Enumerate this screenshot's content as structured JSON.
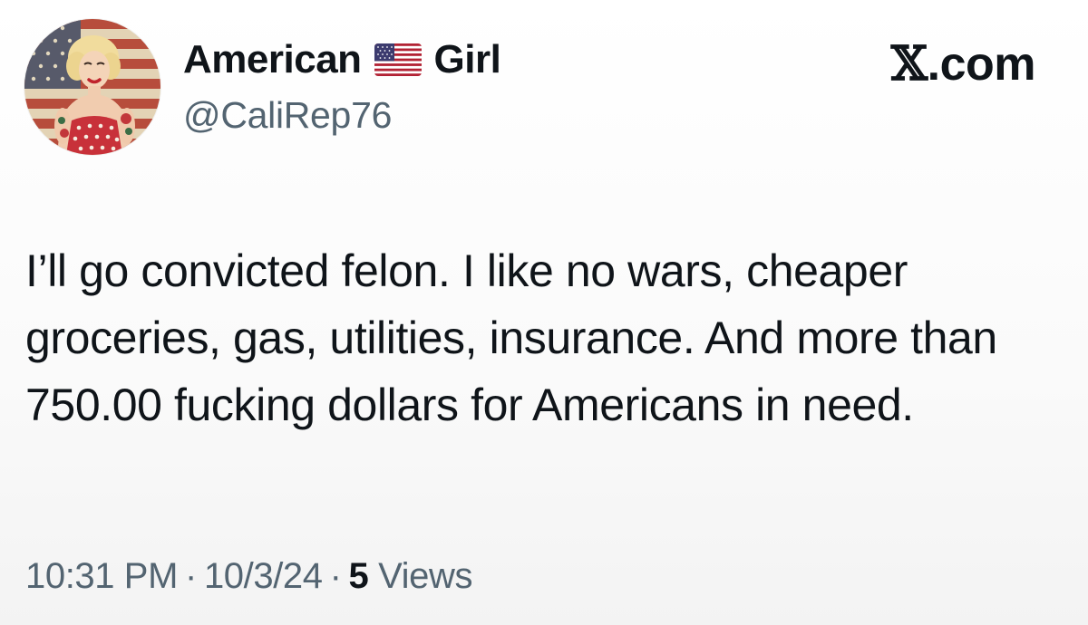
{
  "author": {
    "name_first": "American",
    "name_flag_icon": "us-flag-emoji-icon",
    "name_last": "Girl",
    "handle": "@CaliRep76",
    "avatar_icon": "pinup-girl-american-flag-avatar"
  },
  "brand": {
    "x_glyph": "𝕏",
    "text": ".com"
  },
  "tweet": {
    "text": "I’ll go convicted felon. I like no wars, cheaper groceries, gas, utilities, insurance. And more than 750.00 fucking dollars for Americans in need."
  },
  "meta": {
    "time": "10:31 PM",
    "separator": "·",
    "date": "10/3/24",
    "views_count": "5",
    "views_label": "Views"
  },
  "colors": {
    "text_primary": "#0f1419",
    "text_secondary": "#536471",
    "flag_red": "#b22234",
    "flag_blue": "#3c3b6e"
  }
}
